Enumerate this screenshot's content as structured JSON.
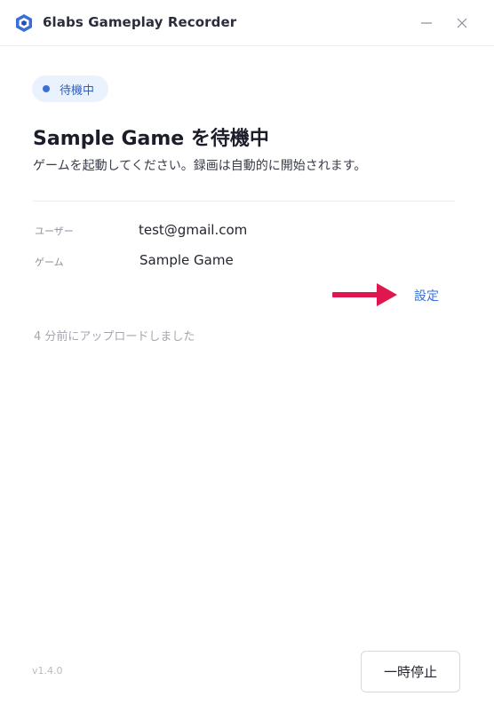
{
  "window": {
    "title": "6labs Gameplay Recorder",
    "logo_icon": "6labs-logo-icon",
    "minimize_icon": "minimize-icon",
    "close_icon": "close-icon"
  },
  "status": {
    "label": "待機中",
    "dot_color": "#3a6fd8"
  },
  "main": {
    "heading": "Sample Game を待機中",
    "subtext": "ゲームを起動してください。録画は自動的に開始されます。"
  },
  "info": {
    "user_label": "ユーザー",
    "user_value": "test@gmail.com",
    "game_label": "ゲーム",
    "game_value": "Sample Game"
  },
  "settings_link": "設定",
  "annotation": {
    "arrow_icon": "right-arrow-icon",
    "arrow_color": "#e0174f"
  },
  "upload_status": "4 分前にアップロードしました",
  "footer": {
    "version": "v1.4.0",
    "pause_button": "一時停止"
  },
  "colors": {
    "accent": "#3a6fd8",
    "pill_background": "#eaf2fd"
  }
}
